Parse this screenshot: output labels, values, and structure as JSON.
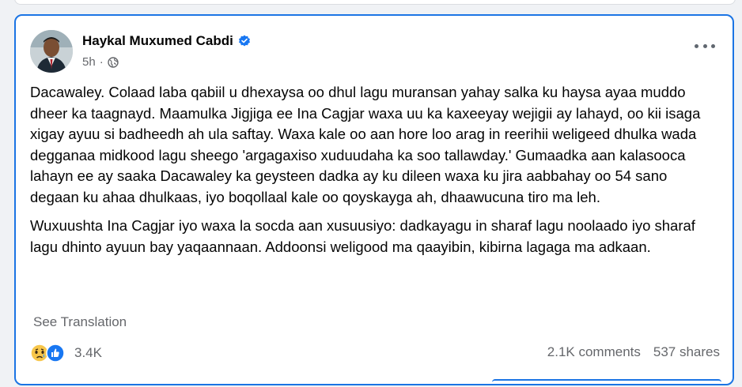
{
  "post": {
    "author": "Haykal Muxumed Cabdi",
    "time": "5h",
    "paragraphs": [
      "Dacawaley. Colaad laba qabiil u dhexaysa oo dhul lagu muransan yahay salka ku haysa ayaa muddo dheer ka taagnayd. Maamulka Jigjiga ee Ina Cagjar waxa uu ka kaxeeyay wejigii ay lahayd, oo kii isaga xigay ayuu si badheedh ah ula saftay. Waxa kale oo aan hore loo arag in reerihii weligeed dhulka wada degganaa midkood lagu sheego 'argagaxiso xuduudaha ka soo tallawday.' Gumaadka aan kalasooca lahayn ee ay saaka Dacawaley ka geysteen dadka ay ku dileen waxa ku jira aabbahay oo 54 sano degaan ku ahaa dhulkaas, iyo boqollaal kale oo qoyskayga ah, dhaawucuna tiro ma leh.",
      "Wuxuushta Ina Cagjar iyo waxa la socda aan xusuusiyo: dadkayagu in sharaf lagu noolaado iyo sharaf lagu dhinto ayuun bay yaqaannaan. Addoonsi weligood ma qaayibin, kibirna lagaga ma adkaan."
    ],
    "see_translation": "See Translation",
    "reactions_count": "3.4K",
    "comments": "2.1K comments",
    "shares": "537 shares"
  }
}
